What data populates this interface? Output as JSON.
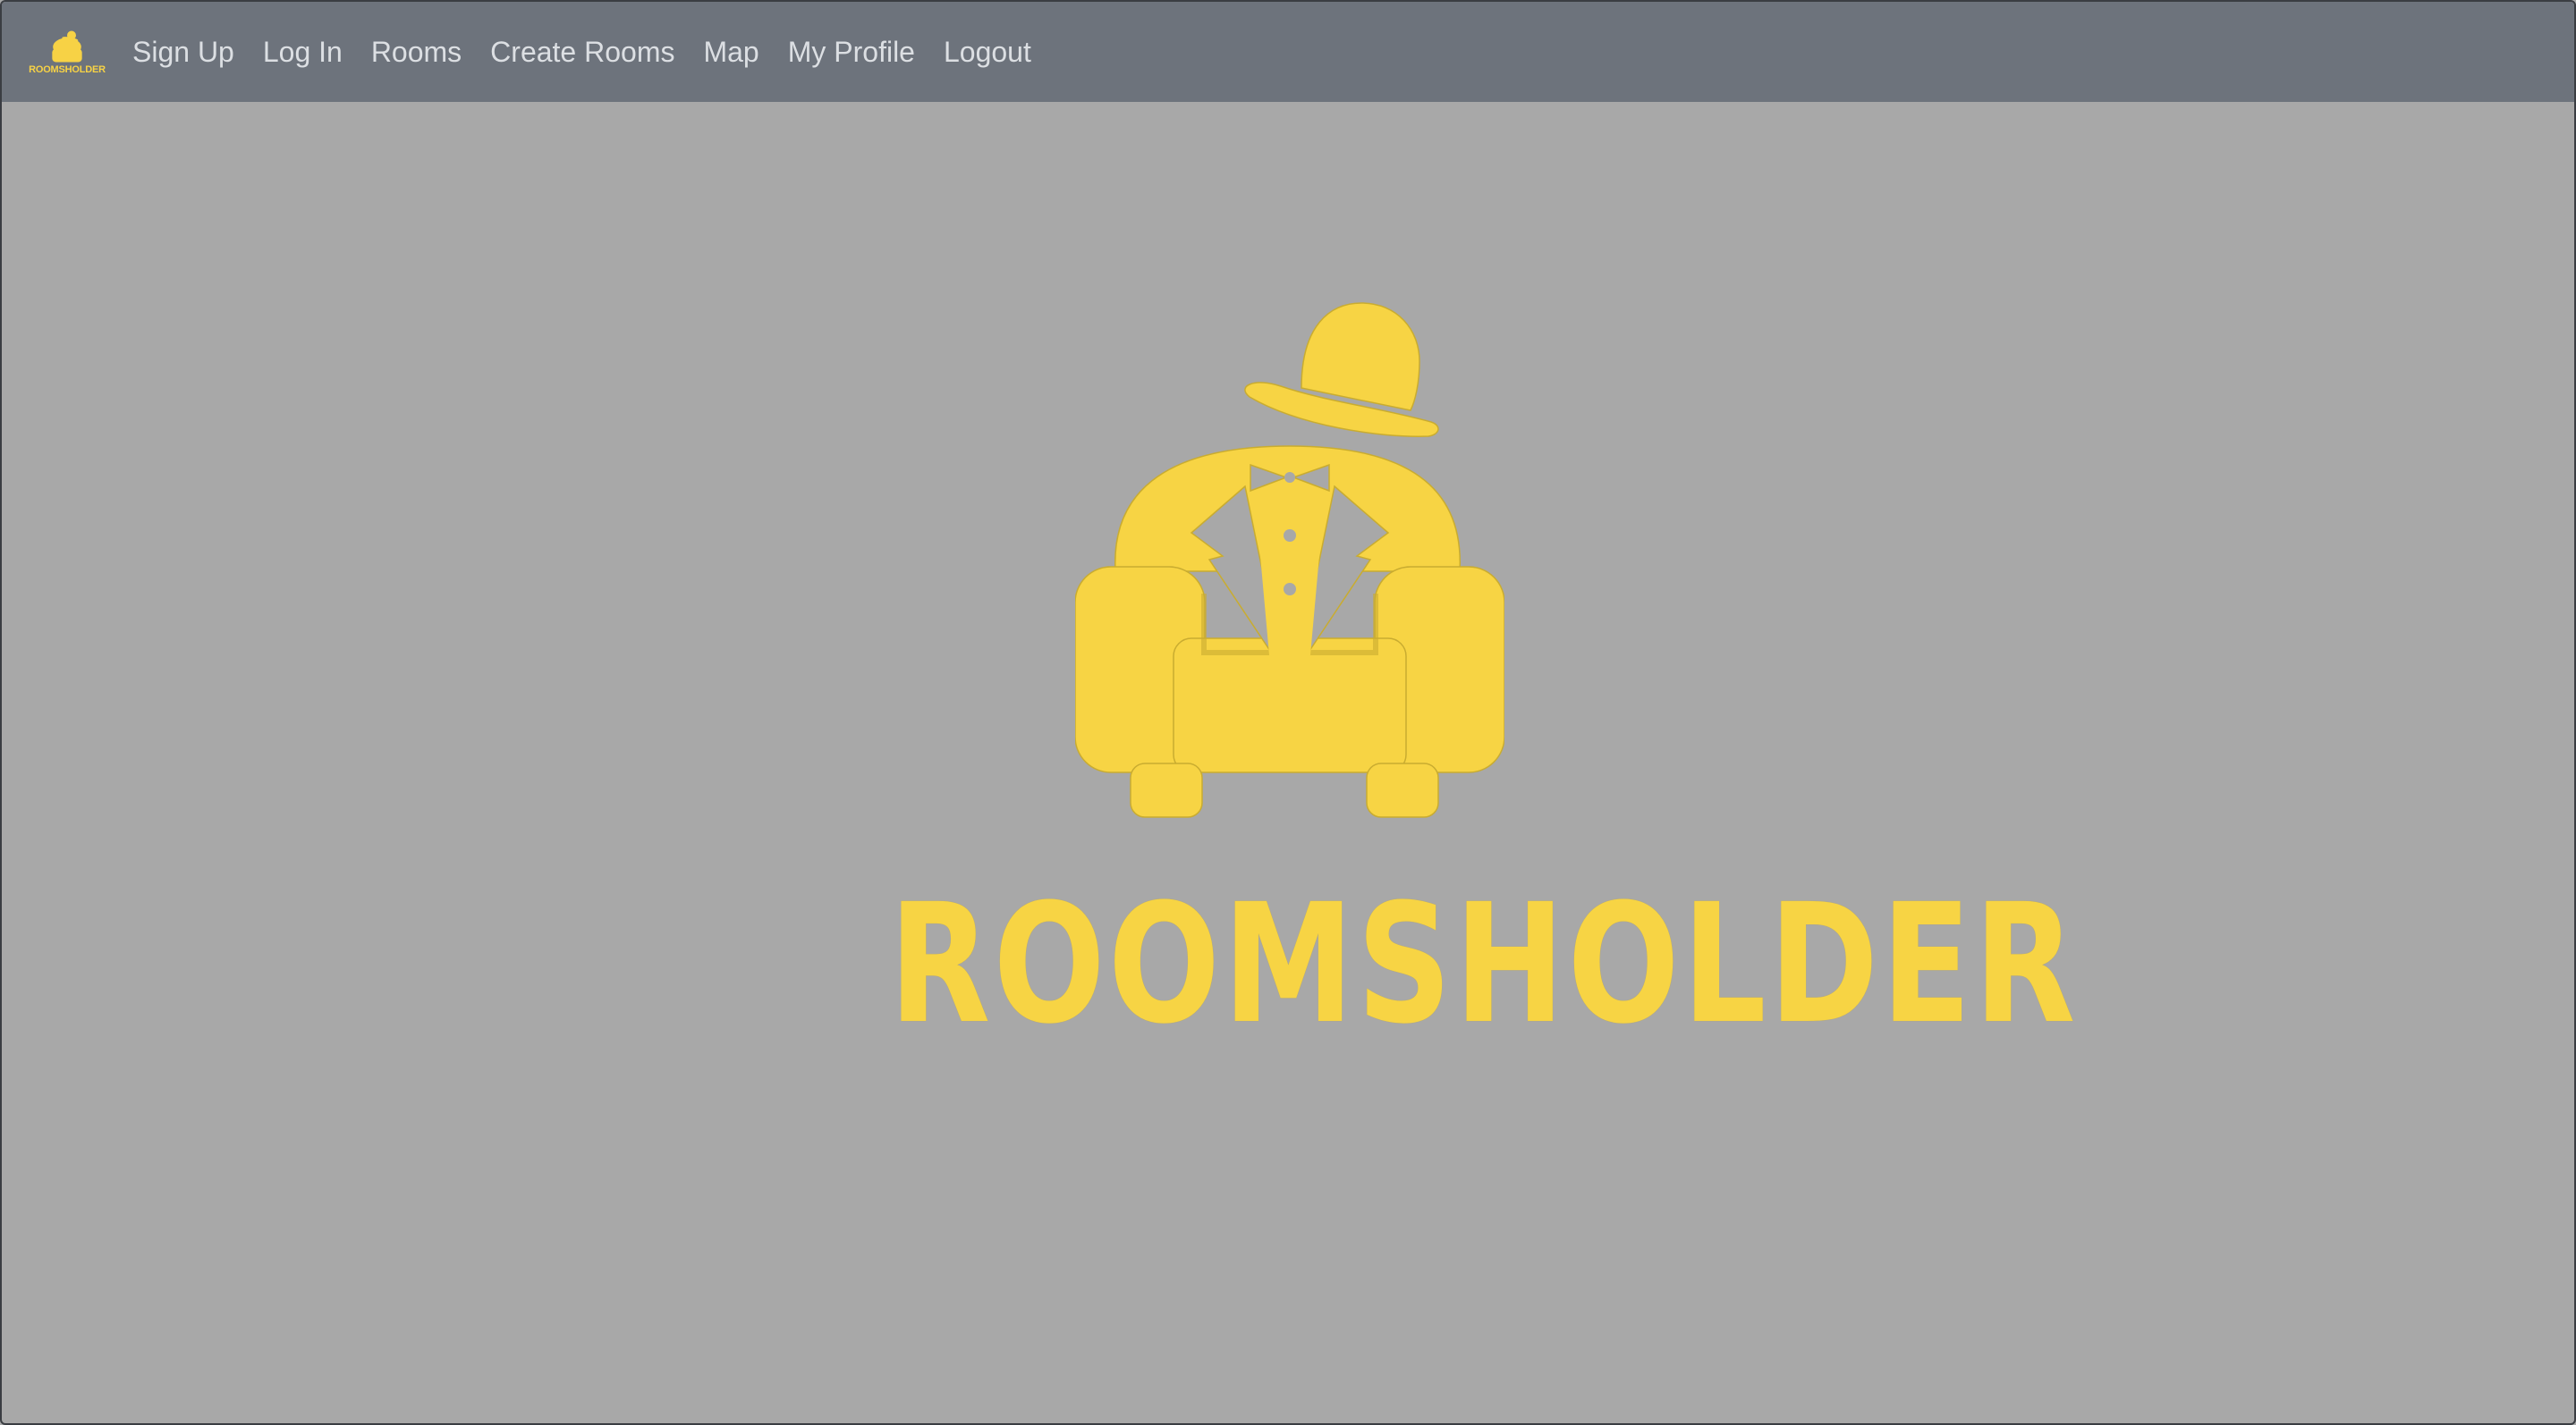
{
  "navbar": {
    "brand_text": "ROOMSHOLDER",
    "links": [
      {
        "label": "Sign Up"
      },
      {
        "label": "Log In"
      },
      {
        "label": "Rooms"
      },
      {
        "label": "Create Rooms"
      },
      {
        "label": "Map"
      },
      {
        "label": "My Profile"
      },
      {
        "label": "Logout"
      }
    ]
  },
  "hero": {
    "wordmark": "ROOMSHOLDER",
    "logo_icon": "armchair-bowler-hat-tuxedo-icon"
  },
  "colors": {
    "navbar_bg": "#6d737c",
    "page_bg": "#a8a8a8",
    "brand_yellow": "#f7d444",
    "link_text": "#dcdfe3"
  }
}
